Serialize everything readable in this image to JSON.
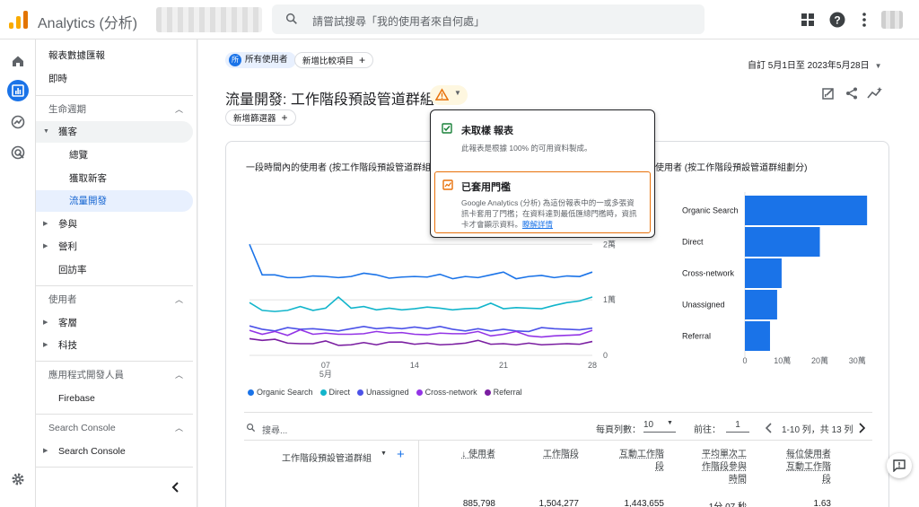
{
  "app": {
    "title": "Analytics (分析)"
  },
  "search": {
    "placeholder": "請嘗試搜尋「我的使用者來自何處」"
  },
  "sidebar": {
    "top_items": [
      "報表數據匯報",
      "即時"
    ],
    "sections": [
      {
        "label": "生命週期",
        "items": [
          {
            "label": "獲客",
            "expanded": true,
            "children": [
              "總覽",
              "獲取新客",
              "流量開發"
            ]
          },
          {
            "label": "參與"
          },
          {
            "label": "營利"
          },
          {
            "label": "回訪率"
          }
        ]
      },
      {
        "label": "使用者",
        "items": [
          {
            "label": "客層"
          },
          {
            "label": "科技"
          }
        ]
      },
      {
        "label": "應用程式開發人員",
        "items": [
          {
            "label": "Firebase"
          }
        ]
      },
      {
        "label": "Search Console",
        "items": [
          {
            "label": "Search Console"
          }
        ]
      }
    ]
  },
  "header": {
    "user_chip": "所有使用者",
    "user_chip_badge": "所",
    "compare_chip": "新增比較項目",
    "date_range": "自訂  5月1日至 2023年5月28日",
    "title": "流量開發: 工作階段預設管道群組",
    "filter_chip": "新增篩選器"
  },
  "popup": {
    "sec1_title": "未取樣 報表",
    "sec1_body": "此報表是根據 100% 的可用資料製成。",
    "sec2_title": "已套用門檻",
    "sec2_body_1": "Google Analytics (分析) 為這份報表中的一或多張資",
    "sec2_body_2": "訊卡套用了門檻；在資料達到最低匯總門檻時，資訊",
    "sec2_body_3": "卡才會顯示資料。",
    "sec2_link": "瞭解詳情"
  },
  "line_chart": {
    "title": "一段時間內的使用者 (按工作階段預設管道群組",
    "y_ticks": [
      "2萬",
      "1萬",
      "0"
    ],
    "x_ticks": [
      "07",
      "14",
      "21",
      "28"
    ],
    "x_sub": "5月"
  },
  "bar_chart": {
    "title": "使用者 (按工作階段預設管道群組劃分)",
    "x_ticks": [
      "0",
      "10萬",
      "20萬",
      "30萬"
    ]
  },
  "chart_data": [
    {
      "type": "line",
      "x": [
        1,
        2,
        3,
        4,
        5,
        6,
        7,
        8,
        9,
        10,
        11,
        12,
        13,
        14,
        15,
        16,
        17,
        18,
        19,
        20,
        21,
        22,
        23,
        24,
        25,
        26,
        27,
        28
      ],
      "ylim": [
        0,
        32000
      ],
      "series": [
        {
          "name": "Organic Search",
          "color": "#1a73e8",
          "values": [
            20000,
            14500,
            14500,
            14000,
            14000,
            14300,
            14200,
            14000,
            14200,
            14800,
            14500,
            13900,
            14100,
            14200,
            14100,
            14600,
            13800,
            14200,
            14000,
            14500,
            15000,
            13800,
            14200,
            14400,
            14000,
            14300,
            14200,
            15000
          ]
        },
        {
          "name": "Direct",
          "color": "#12b5cb",
          "values": [
            9500,
            8100,
            7900,
            8100,
            8800,
            8100,
            8500,
            10500,
            8500,
            8800,
            8200,
            8500,
            8200,
            8400,
            8700,
            8500,
            8200,
            8400,
            8500,
            9400,
            8400,
            8600,
            8500,
            8400,
            9000,
            9500,
            9800,
            10500
          ]
        },
        {
          "name": "Unassigned",
          "color": "#4c52e8",
          "values": [
            5300,
            4700,
            4400,
            5000,
            4700,
            4800,
            4600,
            4400,
            4800,
            5200,
            4800,
            5000,
            4800,
            5100,
            4800,
            5200,
            4700,
            4400,
            4800,
            4400,
            4700,
            4400,
            4300,
            5000,
            4800,
            4700,
            4600,
            4900
          ]
        },
        {
          "name": "Cross-network",
          "color": "#9334e6",
          "values": [
            4500,
            3800,
            4300,
            3600,
            4600,
            3800,
            4000,
            3800,
            3800,
            3900,
            4300,
            4000,
            4100,
            3800,
            3700,
            4000,
            3900,
            3900,
            4300,
            3500,
            3800,
            4300,
            3500,
            3300,
            3500,
            3600,
            3700,
            4500
          ]
        },
        {
          "name": "Referral",
          "color": "#7a1ea1",
          "values": [
            3000,
            2700,
            2900,
            2200,
            2100,
            2100,
            2600,
            1800,
            1900,
            2300,
            1900,
            2400,
            2400,
            2000,
            2200,
            1900,
            2000,
            2200,
            2700,
            2000,
            2100,
            1900,
            2200,
            1900,
            2000,
            2100,
            2000,
            2500
          ]
        }
      ]
    },
    {
      "type": "bar",
      "orientation": "horizontal",
      "categories": [
        "Organic Search",
        "Direct",
        "Cross-network",
        "Unassigned",
        "Referral"
      ],
      "values": [
        326000,
        200000,
        98000,
        86000,
        67000
      ],
      "xlim": [
        0,
        340000
      ],
      "color": "#1a73e8"
    }
  ],
  "table": {
    "search_placeholder": "搜尋...",
    "rows_per_page_label": "每頁列數：",
    "rows_per_page": "10",
    "goto_label": "前往：",
    "goto_value": "1",
    "pagination": "1-10 列，共 13 列",
    "dim_header": "工作階段預設管道群組",
    "columns": [
      {
        "label_1": "使用者",
        "label_2": "",
        "label_3": "",
        "total": "885,798"
      },
      {
        "label_1": "工作階段",
        "label_2": "",
        "label_3": "",
        "total": "1,504,277"
      },
      {
        "label_1": "互動工作階",
        "label_2": "段",
        "label_3": "",
        "total": "1,443,655"
      },
      {
        "label_1": "平均單次工",
        "label_2": "作階段參與",
        "label_3": "時間",
        "total": "1分 07 秒"
      },
      {
        "label_1": "每位使用者",
        "label_2": "互動工作階",
        "label_3": "段",
        "total": "1.63"
      }
    ]
  }
}
